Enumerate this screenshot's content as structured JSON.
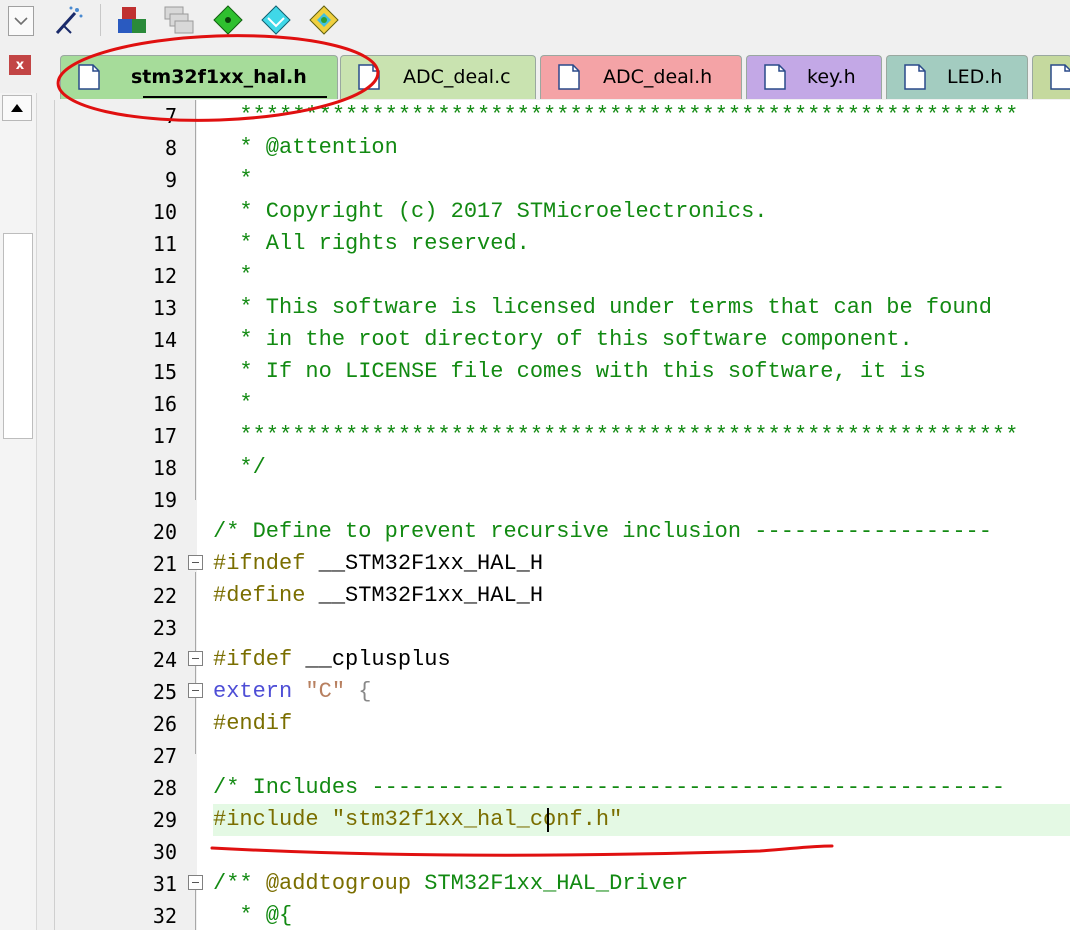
{
  "toolbar": {
    "items": [
      "chevron-down-icon",
      "magic-wand-icon",
      "load-icon",
      "stack-icon",
      "green-diamond-icon",
      "cyan-diamond-icon",
      "multi-diamond-icon"
    ],
    "close_label": "x"
  },
  "tabs": [
    {
      "label": "stm32f1xx_hal.h",
      "color": "#a6dc9a",
      "active": true
    },
    {
      "label": "ADC_deal.c",
      "color": "#c9e3b0",
      "active": false
    },
    {
      "label": "ADC_deal.h",
      "color": "#f4a3a6",
      "active": false
    },
    {
      "label": "key.h",
      "color": "#c3a8e6",
      "active": false
    },
    {
      "label": "LED.h",
      "color": "#a3ccc0",
      "active": false
    },
    {
      "label": "",
      "color": "#c5d99e",
      "active": false
    }
  ],
  "editor": {
    "lines": [
      {
        "n": "7",
        "html": "<span class='cmt'>  ***********************************************************</span>"
      },
      {
        "n": "8",
        "html": "<span class='cmt'>  * @attention</span>"
      },
      {
        "n": "9",
        "html": "<span class='cmt'>  *</span>"
      },
      {
        "n": "10",
        "html": "<span class='cmt'>  * Copyright (c) 2017 STMicroelectronics.</span>"
      },
      {
        "n": "11",
        "html": "<span class='cmt'>  * All rights reserved.</span>"
      },
      {
        "n": "12",
        "html": "<span class='cmt'>  *</span>"
      },
      {
        "n": "13",
        "html": "<span class='cmt'>  * This software is licensed under terms that can be found</span>"
      },
      {
        "n": "14",
        "html": "<span class='cmt'>  * in the root directory of this software component.</span>"
      },
      {
        "n": "15",
        "html": "<span class='cmt'>  * If no LICENSE file comes with this software, it is</span>"
      },
      {
        "n": "16",
        "html": "<span class='cmt'>  *</span>"
      },
      {
        "n": "17",
        "html": "<span class='cmt'>  ***********************************************************</span>"
      },
      {
        "n": "18",
        "html": "<span class='cmt'>  */</span>"
      },
      {
        "n": "19",
        "html": ""
      },
      {
        "n": "20",
        "html": "<span class='cmt'>/* Define to prevent recursive inclusion ------------------</span>"
      },
      {
        "n": "21",
        "html": "<span class='pp'>#ifndef</span> <span class='id'>__STM32F1xx_HAL_H</span>",
        "fold": true
      },
      {
        "n": "22",
        "html": "<span class='pp'>#define</span> <span class='id'>__STM32F1xx_HAL_H</span>"
      },
      {
        "n": "23",
        "html": ""
      },
      {
        "n": "24",
        "html": "<span class='pp'>#ifdef</span> <span class='id'>__cplusplus</span>",
        "fold": true
      },
      {
        "n": "25",
        "html": "<span class='kw'>extern</span> <span class='str'>\"C\"</span> <span class='br'>{</span>",
        "fold": true
      },
      {
        "n": "26",
        "html": "<span class='pp'>#endif</span>"
      },
      {
        "n": "27",
        "html": ""
      },
      {
        "n": "28",
        "html": "<span class='cmt'>/* Includes ------------------------------------------------</span>"
      },
      {
        "n": "29",
        "html": "<span class='pp'>#include \"stm32f1xx_hal_conf.h\"</span>",
        "highlight": true
      },
      {
        "n": "30",
        "html": ""
      },
      {
        "n": "31",
        "html": "<span class='cmt'>/** </span><span class='pp'>@addtogroup</span><span class='cmt'> STM32F1xx_HAL_Driver</span>",
        "fold": true
      },
      {
        "n": "32",
        "html": "<span class='cmt'>  * @{</span>"
      }
    ]
  }
}
